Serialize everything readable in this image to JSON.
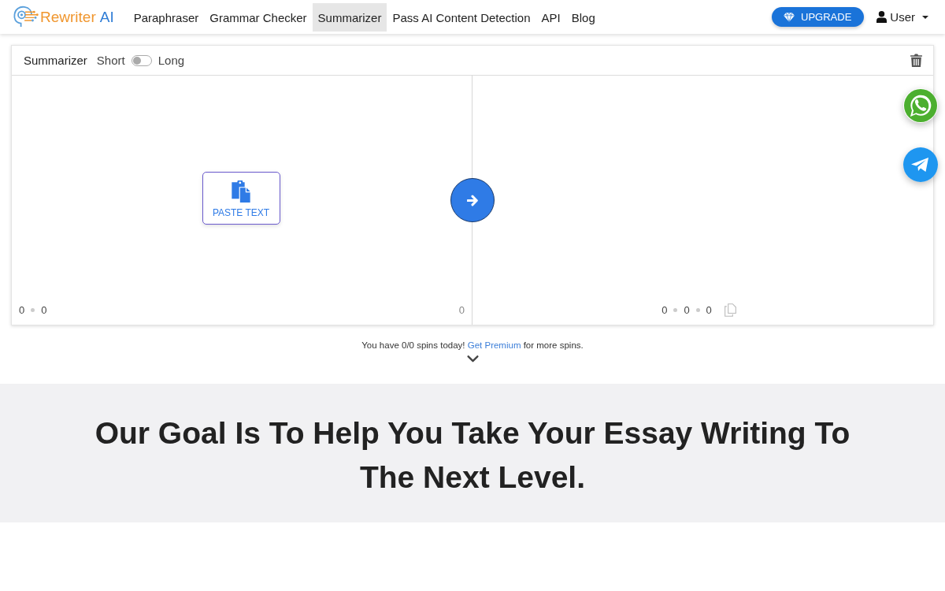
{
  "navbar": {
    "brand": {
      "name": "Rewriter",
      "suffix": "AI"
    },
    "links": [
      {
        "label": "Paraphraser",
        "selected": false
      },
      {
        "label": "Grammar Checker",
        "selected": false
      },
      {
        "label": "Summarizer",
        "selected": true
      },
      {
        "label": "Pass AI Content Detection",
        "selected": false
      },
      {
        "label": "API",
        "selected": false
      },
      {
        "label": "Blog",
        "selected": false
      }
    ],
    "upgrade_button": "UPGRADE",
    "user_menu": "User"
  },
  "editor": {
    "title": "Summarizer",
    "length_toggle": {
      "left_label": "Short",
      "right_label": "Long",
      "on": false
    },
    "input": {
      "paste_button": "PASTE TEXT",
      "counts": [
        "0",
        "0"
      ],
      "right_count": "0"
    },
    "output": {
      "counts": [
        "0",
        "0",
        "0"
      ]
    }
  },
  "notice": {
    "text_before": "You have 0/0 spins today!",
    "link": "Get Premium",
    "text_after": "for more spins."
  },
  "goal": {
    "heading": "Our Goal Is To Help You Take Your Essay Writing To The Next Level."
  }
}
